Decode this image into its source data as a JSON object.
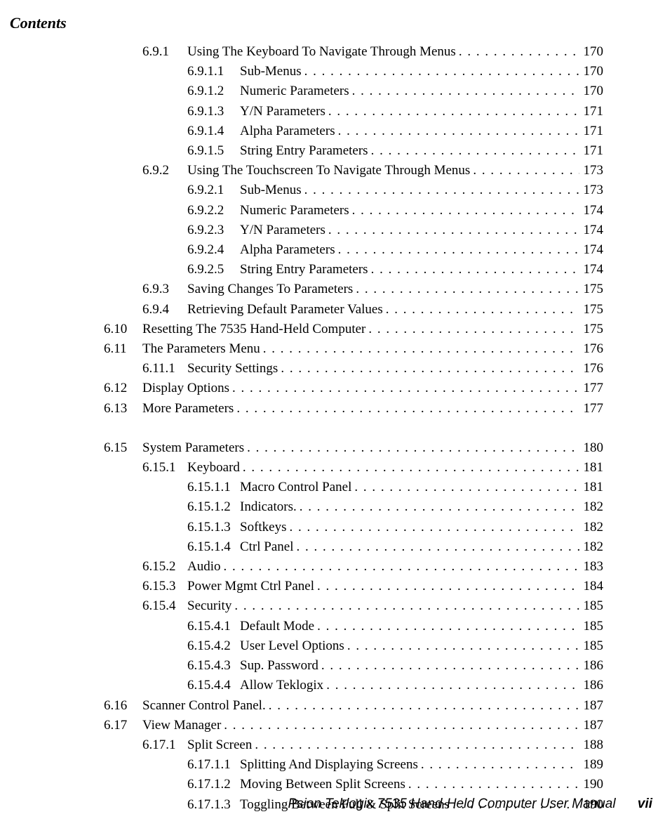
{
  "running_head": "Contents",
  "footer": {
    "manual": "Psion Teklogix 7535 Hand-Held Computer User Manual",
    "page_number": "vii"
  },
  "toc": [
    {
      "level": 1,
      "num": "6.9.1",
      "title": "Using The Keyboard To Navigate Through Menus",
      "page": "170"
    },
    {
      "level": 2,
      "num": "6.9.1.1",
      "title": "Sub-Menus",
      "page": "170"
    },
    {
      "level": 2,
      "num": "6.9.1.2",
      "title": "Numeric Parameters",
      "page": "170"
    },
    {
      "level": 2,
      "num": "6.9.1.3",
      "title": "Y/N Parameters",
      "page": "171"
    },
    {
      "level": 2,
      "num": "6.9.1.4",
      "title": "Alpha Parameters",
      "page": "171"
    },
    {
      "level": 2,
      "num": "6.9.1.5",
      "title": "String Entry Parameters",
      "page": "171"
    },
    {
      "level": 1,
      "num": "6.9.2",
      "title": "Using The Touchscreen To Navigate Through Menus",
      "page": "173"
    },
    {
      "level": 2,
      "num": "6.9.2.1",
      "title": "Sub-Menus",
      "page": "173"
    },
    {
      "level": 2,
      "num": "6.9.2.2",
      "title": "Numeric Parameters",
      "page": "174"
    },
    {
      "level": 2,
      "num": "6.9.2.3",
      "title": "Y/N Parameters",
      "page": "174"
    },
    {
      "level": 2,
      "num": "6.9.2.4",
      "title": "Alpha Parameters",
      "page": "174"
    },
    {
      "level": 2,
      "num": "6.9.2.5",
      "title": "String Entry Parameters",
      "page": "174"
    },
    {
      "level": 1,
      "num": "6.9.3",
      "title": "Saving Changes To Parameters",
      "page": "175"
    },
    {
      "level": 1,
      "num": "6.9.4",
      "title": "Retrieving Default Parameter Values",
      "page": "175"
    },
    {
      "level": 0,
      "num": "6.10",
      "title": "Resetting The 7535 Hand-Held Computer",
      "page": "175"
    },
    {
      "level": 0,
      "num": "6.11",
      "title": "The Parameters Menu",
      "page": "176"
    },
    {
      "level": 1,
      "num": "6.11.1",
      "title": "Security Settings",
      "page": "176"
    },
    {
      "level": 0,
      "num": "6.12",
      "title": "Display Options",
      "page": "177"
    },
    {
      "level": 0,
      "num": "6.13",
      "title": "More Parameters",
      "page": "177"
    },
    {
      "gap": true
    },
    {
      "level": 0,
      "num": "6.15",
      "title": "System Parameters",
      "page": "180"
    },
    {
      "level": 1,
      "num": "6.15.1",
      "title": "Keyboard",
      "page": "181"
    },
    {
      "level": 2,
      "num": "6.15.1.1",
      "title": "Macro Control Panel",
      "page": "181"
    },
    {
      "level": 2,
      "num": "6.15.1.2",
      "title": "Indicators.",
      "page": "182"
    },
    {
      "level": 2,
      "num": "6.15.1.3",
      "title": "Softkeys",
      "page": "182"
    },
    {
      "level": 2,
      "num": "6.15.1.4",
      "title": "Ctrl Panel",
      "page": "182"
    },
    {
      "level": 1,
      "num": "6.15.2",
      "title": "Audio",
      "page": "183"
    },
    {
      "level": 1,
      "num": "6.15.3",
      "title": "Power Mgmt Ctrl Panel",
      "page": "184"
    },
    {
      "level": 1,
      "num": "6.15.4",
      "title": "Security",
      "page": "185"
    },
    {
      "level": 2,
      "num": "6.15.4.1",
      "title": "Default Mode",
      "page": "185"
    },
    {
      "level": 2,
      "num": "6.15.4.2",
      "title": "User Level Options",
      "page": "185"
    },
    {
      "level": 2,
      "num": "6.15.4.3",
      "title": "Sup. Password",
      "page": "186"
    },
    {
      "level": 2,
      "num": "6.15.4.4",
      "title": "Allow Teklogix",
      "page": "186"
    },
    {
      "level": 0,
      "num": "6.16",
      "title": "Scanner Control Panel.",
      "page": "187"
    },
    {
      "level": 0,
      "num": "6.17",
      "title": "View Manager",
      "page": "187"
    },
    {
      "level": 1,
      "num": "6.17.1",
      "title": "Split Screen",
      "page": "188"
    },
    {
      "level": 2,
      "num": "6.17.1.1",
      "title": "Splitting And Displaying Screens",
      "page": "189"
    },
    {
      "level": 2,
      "num": "6.17.1.2",
      "title": "Moving Between Split Screens",
      "page": "190"
    },
    {
      "level": 2,
      "num": "6.17.1.3",
      "title": "Toggling Between Full & Split Screens",
      "page": "190"
    }
  ]
}
